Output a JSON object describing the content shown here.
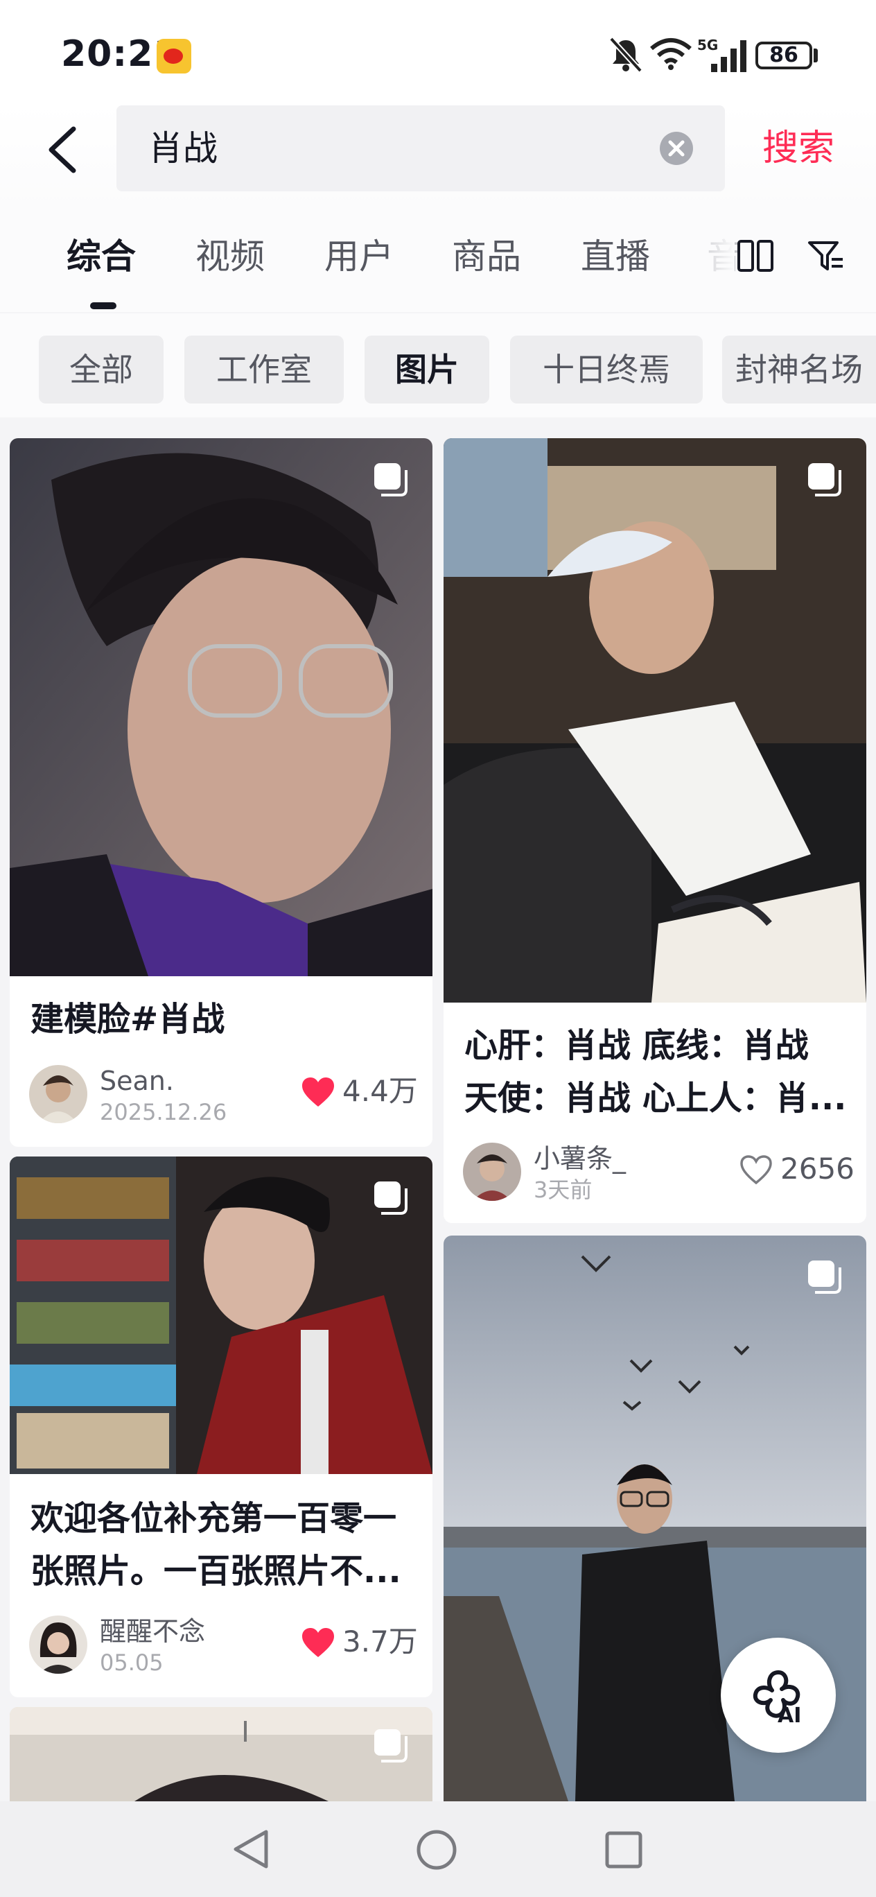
{
  "status_bar": {
    "time": "20:21",
    "battery": "86",
    "network": "5G"
  },
  "search": {
    "query": "肖战",
    "submit_label": "搜索"
  },
  "tabs": [
    {
      "label": "综合",
      "active": true
    },
    {
      "label": "视频"
    },
    {
      "label": "用户"
    },
    {
      "label": "商品"
    },
    {
      "label": "直播"
    },
    {
      "label": "音"
    }
  ],
  "chips": [
    {
      "label": "全部"
    },
    {
      "label": "工作室"
    },
    {
      "label": "图片",
      "active": true
    },
    {
      "label": "十日终焉"
    },
    {
      "label": "封神名场"
    }
  ],
  "cards": [
    {
      "title": "建模脸#肖战",
      "author": "Sean.",
      "date": "2025.12.26",
      "likes": "4.4万",
      "liked": true
    },
    {
      "title_line1": "心肝：肖战 底线：肖战",
      "title_line2": "天使：肖战 心上人：肖...",
      "author": "小薯条_",
      "date": "3天前",
      "likes": "2656",
      "liked": false
    },
    {
      "title_line1": "欢迎各位补充第一百零一",
      "title_line2": "张照片。一百张照片不...",
      "author": "醒醒不念",
      "date": "05.05",
      "likes": "3.7万",
      "liked": true
    },
    {
      "title": ""
    },
    {
      "title": ""
    }
  ],
  "fab": {
    "label": "AI"
  },
  "colors": {
    "accent": "#fe2c55",
    "text": "#161823",
    "muted": "#555760"
  }
}
